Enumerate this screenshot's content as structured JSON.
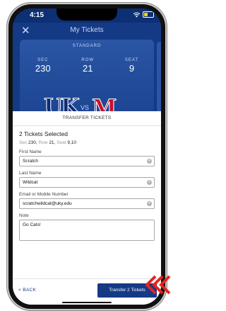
{
  "status": {
    "time": "4:15"
  },
  "appbar": {
    "title": "My Tickets",
    "close": "✕"
  },
  "ticket": {
    "type": "STANDARD",
    "sec_label": "SEC",
    "sec": "230",
    "row_label": "ROW",
    "row": "21",
    "seat_label": "SEAT",
    "seat": "9",
    "home_logo": "UK",
    "vs": "VS",
    "away_logo": "M"
  },
  "sheet": {
    "title": "TRANSFER TICKETS",
    "count": "2 Tickets Selected",
    "sec_label": "Sec",
    "sec": "230,",
    "row_label": "Row",
    "row": "21,",
    "seat_label": "Seat",
    "seats": "9,10"
  },
  "form": {
    "first_label": "First Name",
    "first_value": "Scratch",
    "last_label": "Last Name",
    "last_value": "Wildcat",
    "email_label": "Email or Mobile Number",
    "email_value": "scratchwildcat@uky.edu",
    "note_label": "Note",
    "note_value": "Go Cats!"
  },
  "actions": {
    "back": "< BACK",
    "transfer": "Transfer 2 Tickets"
  },
  "colors": {
    "primary": "#143a86",
    "accent": "#c8102e"
  },
  "icons": [
    "close-icon",
    "wifi-icon",
    "battery-icon",
    "clear-icon",
    "arrow-indicator-icon"
  ]
}
